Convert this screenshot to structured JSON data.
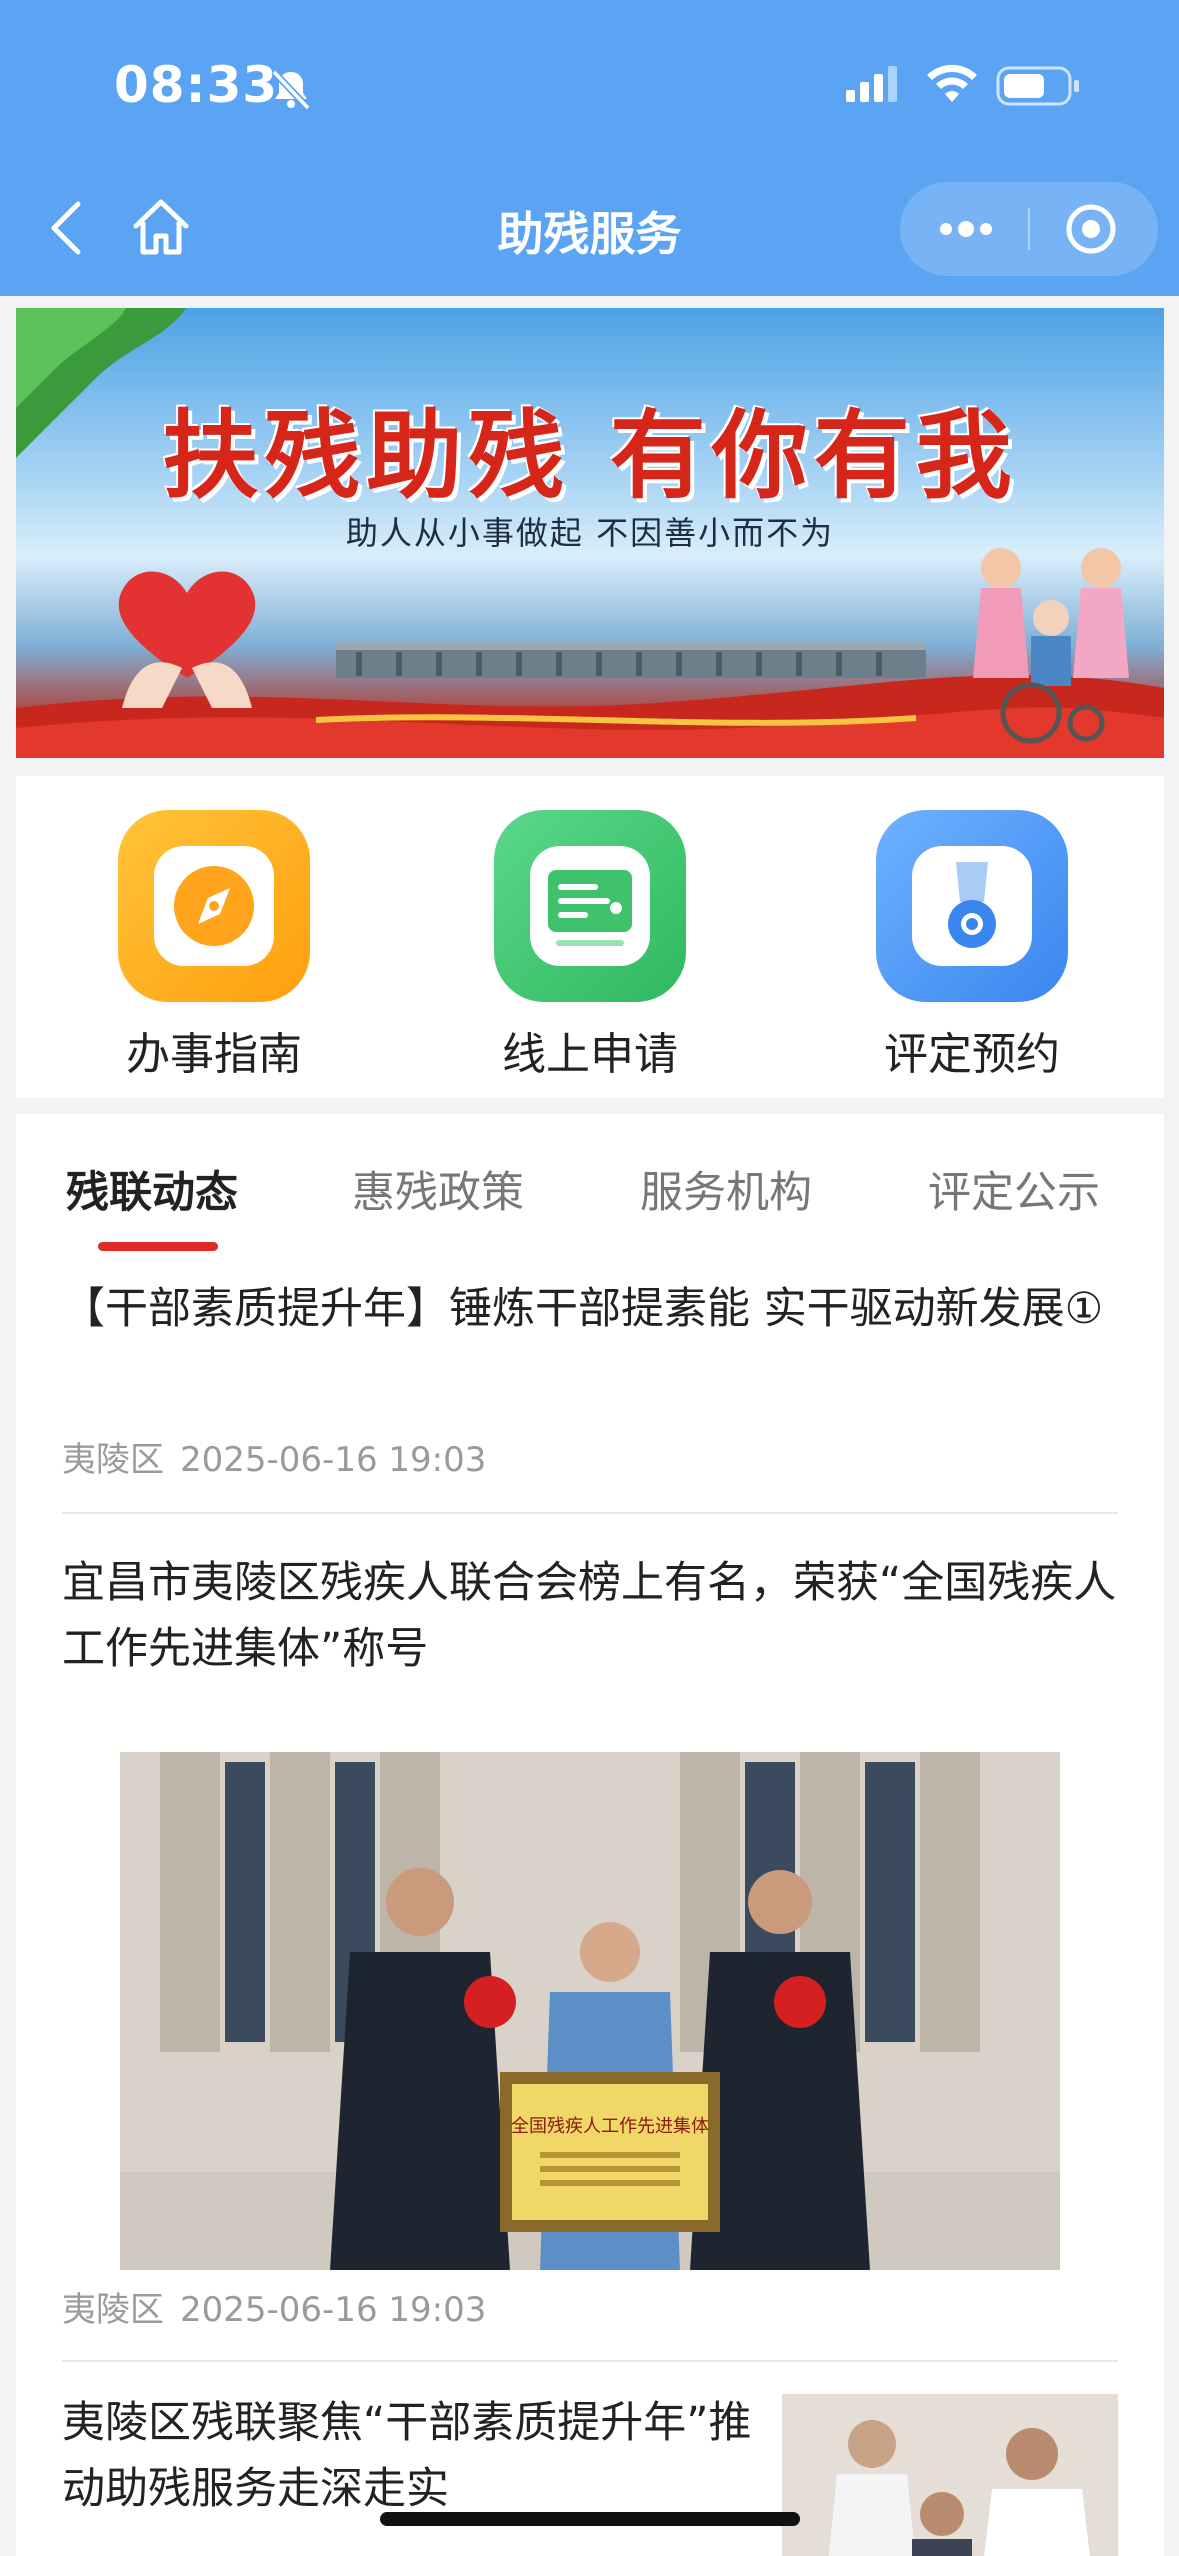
{
  "status_bar": {
    "time": "08:33"
  },
  "nav": {
    "title": "助残服务"
  },
  "banner": {
    "headline": "扶残助残  有你有我",
    "subline": "助人从小事做起  不因善小而不为"
  },
  "quick_actions": [
    {
      "label": "办事指南",
      "icon": "compass-icon",
      "color": "#ffb21e"
    },
    {
      "label": "线上申请",
      "icon": "form-icon",
      "color": "#3ec36b"
    },
    {
      "label": "评定预约",
      "icon": "medal-icon",
      "color": "#3d8bf2"
    }
  ],
  "tabs": [
    {
      "label": "残联动态",
      "active": true
    },
    {
      "label": "惠残政策",
      "active": false
    },
    {
      "label": "服务机构",
      "active": false
    },
    {
      "label": "评定公示",
      "active": false
    }
  ],
  "articles": [
    {
      "title": "【干部素质提升年】锤炼干部提素能 实干驱动新发展①",
      "source": "夷陵区",
      "date": "2025-06-16 19:03"
    },
    {
      "title": "宜昌市夷陵区残疾人联合会榜上有名，荣获“全国残疾人工作先进集体”称号",
      "source": "夷陵区",
      "date": "2025-06-16 19:03",
      "plaque_text": "全国残疾人工作先进集体"
    },
    {
      "title": "夷陵区残联聚焦“干部素质提升年”推动助残服务走深走实"
    }
  ],
  "colors": {
    "header": "#5ba4f3",
    "accent": "#e02a2a",
    "banner_headline": "#d6261a"
  }
}
